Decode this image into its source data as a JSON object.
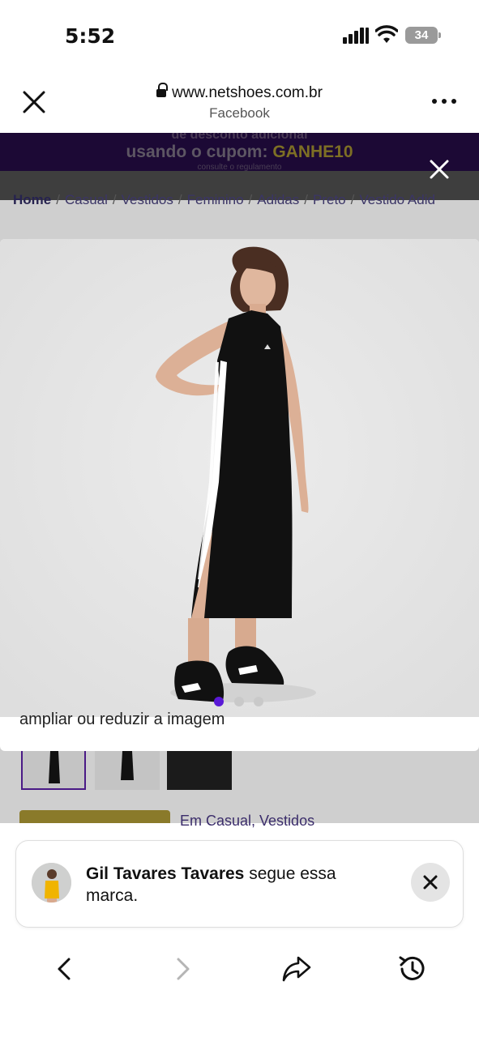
{
  "status": {
    "time": "5:52",
    "battery": "34"
  },
  "browser": {
    "url": "www.netshoes.com.br",
    "source": "Facebook"
  },
  "page": {
    "banner": {
      "line1": "de desconto adicional",
      "line2_prefix": "usando o cupom: ",
      "coupon": "GANHE10",
      "line3": "consulte o regulamento"
    },
    "breadcrumbs": [
      "Home",
      "Casual",
      "Vestidos",
      "Feminino",
      "Adidas",
      "Preto",
      "Vestido Adid"
    ],
    "category_text": "Em Casual, Vestidos"
  },
  "modal": {
    "hint": "ampliar ou reduzir a imagem",
    "dots": 3,
    "active_dot": 1
  },
  "notification": {
    "name": "Gil Tavares Tavares",
    "message": " segue essa marca."
  },
  "colors": {
    "accent": "#5a19d6",
    "banner_bg": "#1c0935",
    "dim_overlay": "#cfcfcf"
  }
}
